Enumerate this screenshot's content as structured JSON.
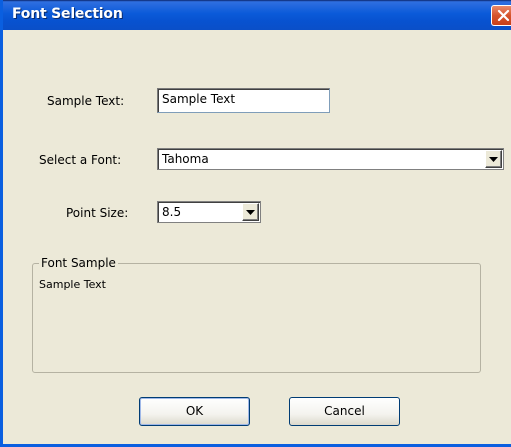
{
  "window": {
    "title": "Font Selection",
    "close_icon": "close-icon"
  },
  "form": {
    "sample_text_label": "Sample Text:",
    "sample_text_value": "Sample Text",
    "font_label": "Select a Font:",
    "font_value": "Tahoma",
    "point_size_label": "Point Size:",
    "point_size_value": "8.5"
  },
  "font_sample": {
    "title": "Font Sample",
    "text": "Sample Text"
  },
  "buttons": {
    "ok": "OK",
    "cancel": "Cancel"
  },
  "colors": {
    "titlebar": "#0b5ad9",
    "close": "#d6542c",
    "dialog_bg": "#ece9d8"
  }
}
